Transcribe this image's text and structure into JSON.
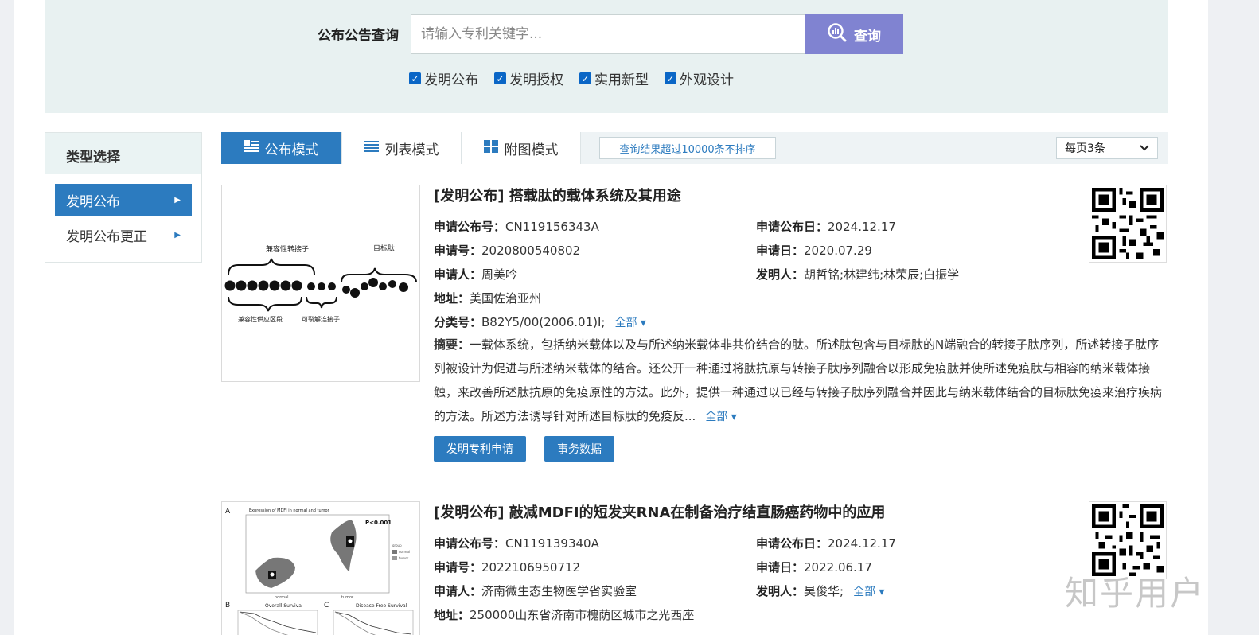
{
  "search": {
    "label": "公布公告查询",
    "placeholder": "请输入专利关键字...",
    "button_label": "查询",
    "checkboxes": [
      {
        "label": "发明公布",
        "checked": true
      },
      {
        "label": "发明授权",
        "checked": true
      },
      {
        "label": "实用新型",
        "checked": true
      },
      {
        "label": "外观设计",
        "checked": true
      }
    ]
  },
  "sidebar": {
    "title": "类型选择",
    "items": [
      {
        "label": "发明公布",
        "active": true
      },
      {
        "label": "发明公布更正",
        "active": false
      }
    ]
  },
  "modes": {
    "items": [
      {
        "label": "公布模式",
        "icon": "publish-mode-icon",
        "active": true
      },
      {
        "label": "列表模式",
        "icon": "list-icon",
        "active": false
      },
      {
        "label": "附图模式",
        "icon": "grid-icon",
        "active": false
      }
    ],
    "notice": "查询结果超过10000条不排序",
    "per_page": "每页3条"
  },
  "records": [
    {
      "title": "[发明公布] 搭载肽的载体系统及其用途",
      "pub_no_label": "申请公布号：",
      "pub_no": "CN119156343A",
      "pub_date_label": "申请公布日：",
      "pub_date": "2024.12.17",
      "app_no_label": "申请号：",
      "app_no": "2020800540802",
      "app_date_label": "申请日：",
      "app_date": "2020.07.29",
      "applicant_label": "申请人：",
      "applicant": "周美吟",
      "inventor_label": "发明人：",
      "inventor": "胡哲铭;林建纬;林荣辰;白振学",
      "address_label": "地址：",
      "address": "美国佐治亚州",
      "class_label": "分类号：",
      "class": "B82Y5/00(2006.01)I;",
      "more_label": "全部",
      "abstract_label": "摘要：",
      "abstract": "一载体系统，包括纳米载体以及与所述纳米载体非共价结合的肽。所述肽包含与目标肽的N端融合的转接子肽序列，所述转接子肽序列被设计为促进与所述纳米载体的结合。还公开一种通过将肽抗原与转接子肽序列融合以形成免疫肽并使所述免疫肽与相容的纳米载体接触，来改善所述肽抗原的免疫原性的方法。此外，提供一种通过以已经与转接子肽序列融合并因此与纳米载体结合的目标肽免疫来治疗疾病的方法。所述方法诱导针对所述目标肽的免疫反...",
      "abstract_more": "全部",
      "btn_apply": "发明专利申请",
      "btn_affairs": "事务数据",
      "figure": {
        "label_top_left": "兼容性转接子",
        "label_top_right": "目标肽",
        "label_bottom_left": "兼容性供应区段",
        "label_bottom_mid": "可裂解连接子"
      }
    },
    {
      "title": "[发明公布] 敲减MDFI的短发夹RNA在制备治疗结直肠癌药物中的应用",
      "pub_no_label": "申请公布号：",
      "pub_no": "CN119139340A",
      "pub_date_label": "申请公布日：",
      "pub_date": "2024.12.17",
      "app_no_label": "申请号：",
      "app_no": "2022106950712",
      "app_date_label": "申请日：",
      "app_date": "2022.06.17",
      "applicant_label": "申请人：",
      "applicant": "济南微生态生物医学省实验室",
      "inventor_label": "发明人：",
      "inventor": "昊俊华;",
      "inventor_more": "全部",
      "address_label": "地址：",
      "address": "250000山东省济南市槐荫区城市之光西座",
      "figure": {
        "panel_a": "A",
        "panel_b": "B",
        "panel_c": "C",
        "title_a": "Expression of MDFI in normal and tumor",
        "pval": "P<0.001",
        "legend_group": "group",
        "legend_normal": "normal",
        "legend_tumor": "tumor",
        "x_normal": "normal",
        "x_tumor": "tumor",
        "title_b": "Overall Survival",
        "title_c": "Disease Free Survival"
      }
    }
  ],
  "watermark": "知乎用户",
  "colors": {
    "accent": "#2c7bbf",
    "search_button": "#8083d1",
    "search_bg": "#e8f1f1"
  }
}
